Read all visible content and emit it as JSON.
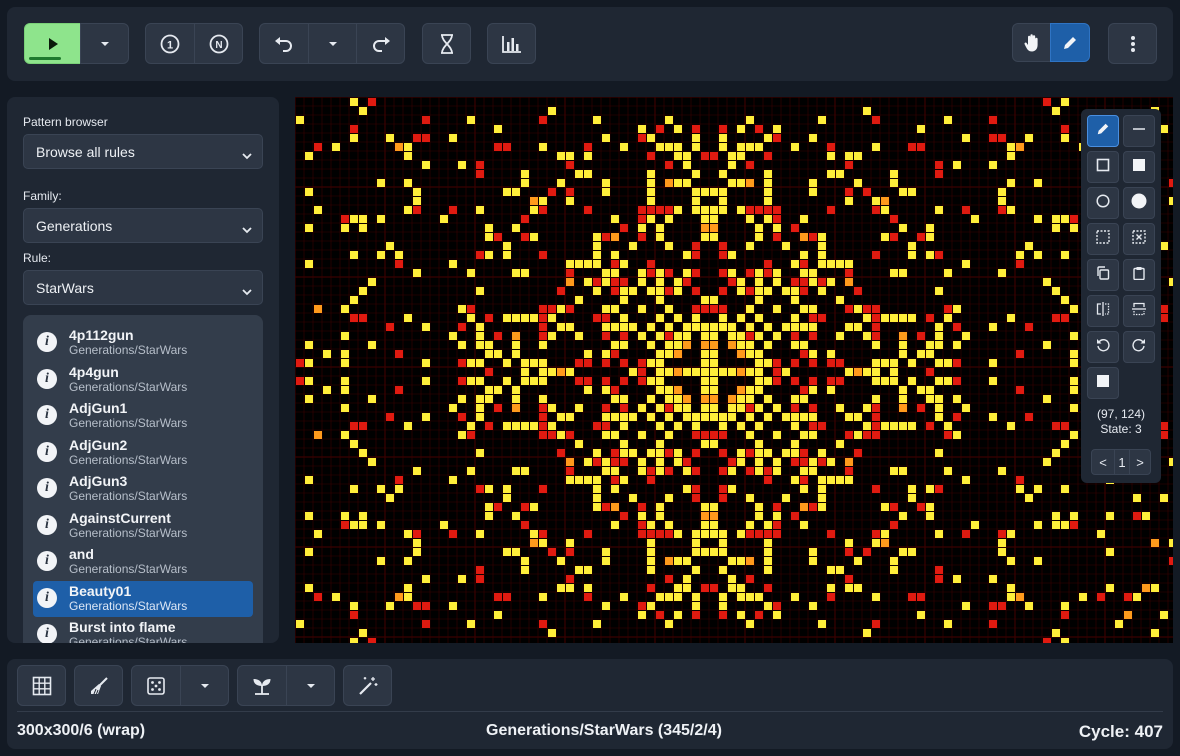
{
  "toolbar": {
    "play_icon": "play-icon",
    "play_progress": 0.6,
    "step_one_icon": "step-one-icon",
    "step_n_icon": "step-n-icon",
    "undo_icon": "undo-icon",
    "redo_icon": "redo-icon",
    "hourglass_icon": "hourglass-icon",
    "stats_icon": "bar-chart-icon",
    "hand_icon": "hand-pan-icon",
    "pencil_icon": "pencil-icon",
    "menu_icon": "vertical-dots-icon"
  },
  "sidebar": {
    "pattern_browser_label": "Pattern browser",
    "pattern_browser_value": "Browse all rules",
    "family_label": "Family:",
    "family_value": "Generations",
    "rule_label": "Rule:",
    "rule_value": "StarWars",
    "patterns": [
      {
        "name": "4p112gun",
        "family": "Generations/StarWars",
        "selected": false
      },
      {
        "name": "4p4gun",
        "family": "Generations/StarWars",
        "selected": false
      },
      {
        "name": "AdjGun1",
        "family": "Generations/StarWars",
        "selected": false
      },
      {
        "name": "AdjGun2",
        "family": "Generations/StarWars",
        "selected": false
      },
      {
        "name": "AdjGun3",
        "family": "Generations/StarWars",
        "selected": false
      },
      {
        "name": "AgainstCurrent",
        "family": "Generations/StarWars",
        "selected": false
      },
      {
        "name": "and",
        "family": "Generations/StarWars",
        "selected": false
      },
      {
        "name": "Beauty01",
        "family": "Generations/StarWars",
        "selected": true
      },
      {
        "name": "Burst into flame",
        "family": "Generations/StarWars",
        "selected": false
      }
    ]
  },
  "draw_panel": {
    "coordinates": "(97, 124)",
    "state": "State: 3",
    "page_prev": "<",
    "page_num": "1",
    "page_next": ">"
  },
  "colors": {
    "cell_state_1": "#ffee3a",
    "cell_state_2": "#ff9a1c",
    "cell_state_3": "#e01a10",
    "grid_line": "#3a0000",
    "accent": "#1e5fa8",
    "play_green": "#8ee48c"
  },
  "bottom": {
    "grid_icon": "grid-icon",
    "clear_icon": "broom-icon",
    "random_icon": "dice-icon",
    "seed_icon": "sprout-icon",
    "magic_icon": "magic-wand-icon",
    "status_left": "300x300/6 (wrap)",
    "status_center": "Generations/StarWars (345/2/4)",
    "status_right": "Cycle: 407"
  }
}
